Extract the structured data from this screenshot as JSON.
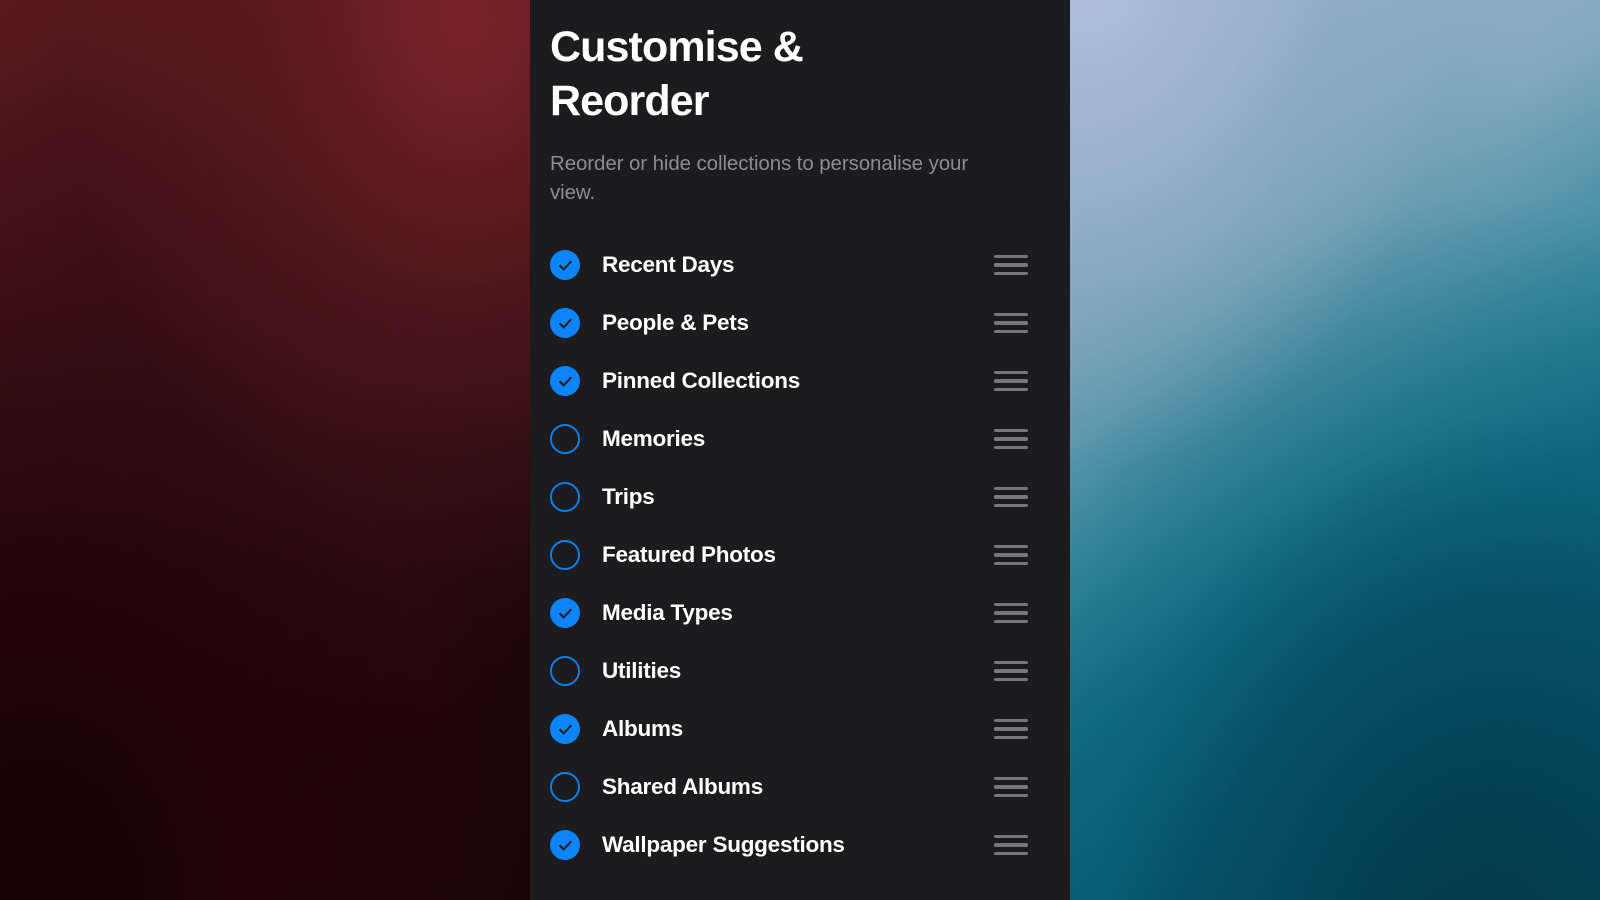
{
  "wallpaper": {
    "left_accent": "#5c1a1f",
    "right_accent": "#0a6a84"
  },
  "sheet": {
    "background": "#1c1c1e",
    "title": "Customise & Reorder",
    "subtitle": "Reorder or hide collections to personalise your view.",
    "accent": "#0b84fe",
    "collections": [
      {
        "label": "Recent Days",
        "checked": true,
        "handle": "drag-handle-icon"
      },
      {
        "label": "People & Pets",
        "checked": true,
        "handle": "drag-handle-icon"
      },
      {
        "label": "Pinned Collections",
        "checked": true,
        "handle": "drag-handle-icon"
      },
      {
        "label": "Memories",
        "checked": false,
        "handle": "drag-handle-icon"
      },
      {
        "label": "Trips",
        "checked": false,
        "handle": "drag-handle-icon"
      },
      {
        "label": "Featured Photos",
        "checked": false,
        "handle": "drag-handle-icon"
      },
      {
        "label": "Media Types",
        "checked": true,
        "handle": "drag-handle-icon"
      },
      {
        "label": "Utilities",
        "checked": false,
        "handle": "drag-handle-icon"
      },
      {
        "label": "Albums",
        "checked": true,
        "handle": "drag-handle-icon"
      },
      {
        "label": "Shared Albums",
        "checked": false,
        "handle": "drag-handle-icon"
      },
      {
        "label": "Wallpaper Suggestions",
        "checked": true,
        "handle": "drag-handle-icon"
      }
    ]
  }
}
